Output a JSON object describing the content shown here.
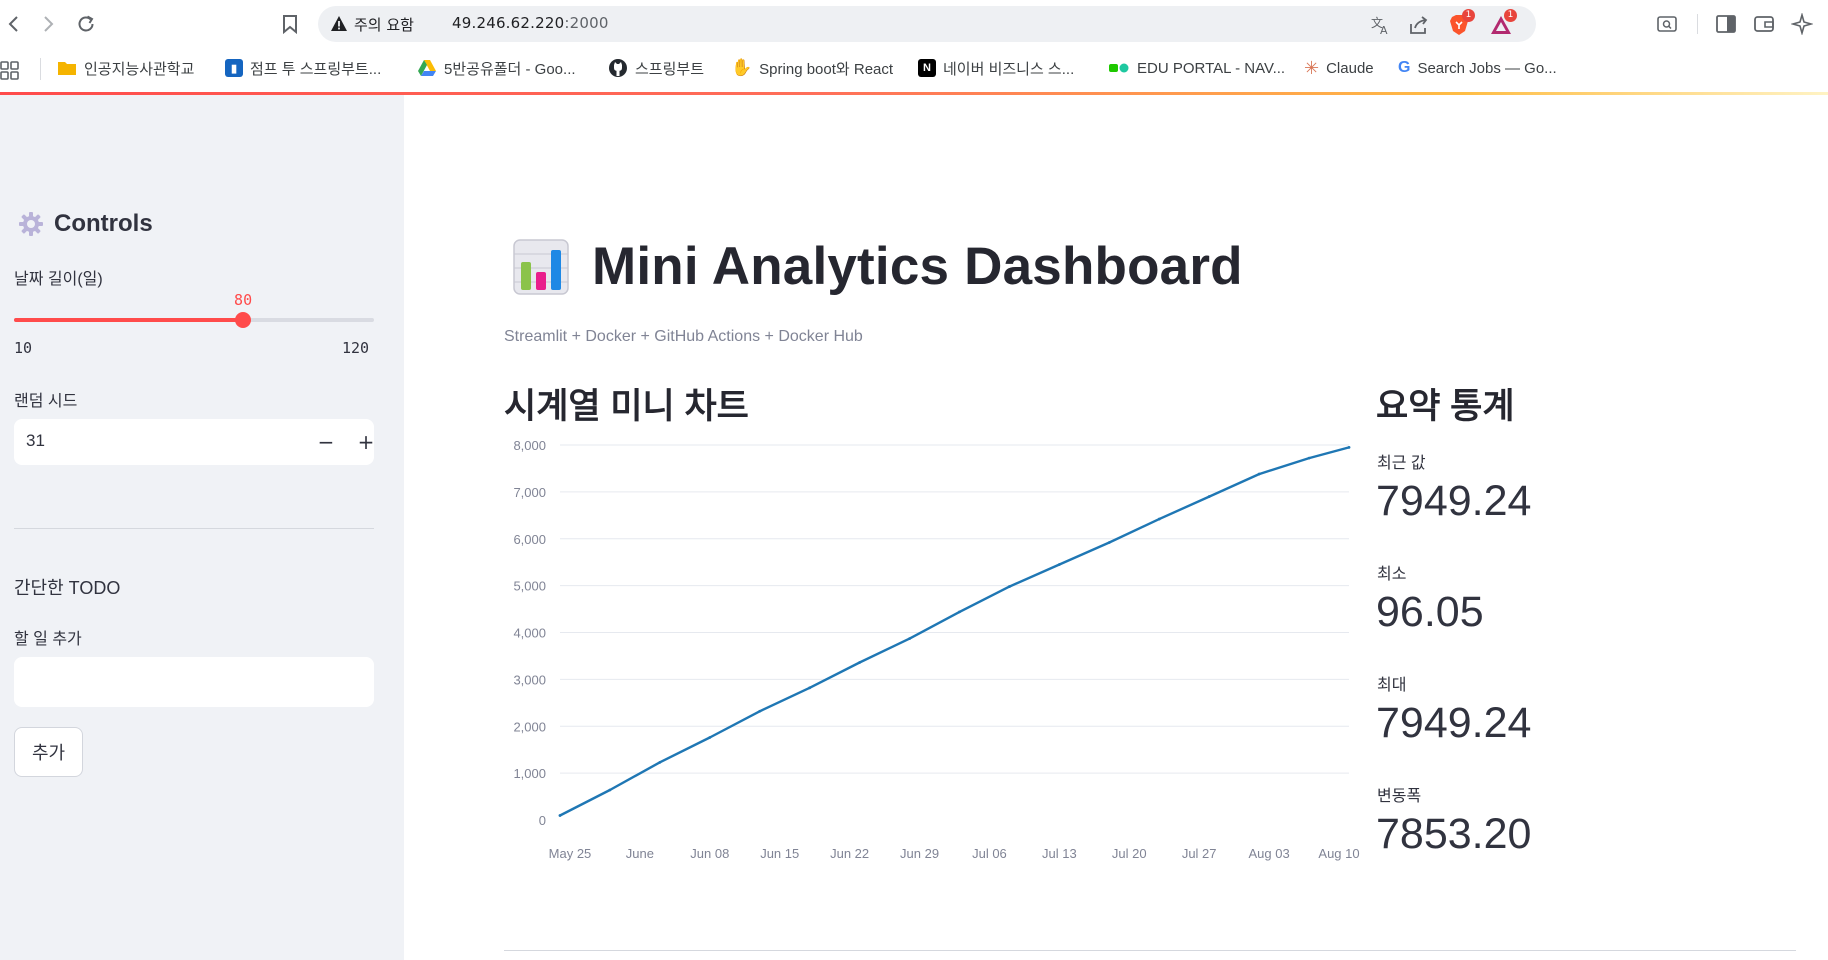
{
  "browser": {
    "security_warning": "주의 요함",
    "url_host": "49.246.62.220",
    "url_port": ":2000",
    "brave_badge": "1",
    "rewards_badge": "1"
  },
  "bookmarks": [
    {
      "label": "인공지능사관학교",
      "icon": "folder-icon",
      "color": "#f5b400"
    },
    {
      "label": "점프 투 스프링부트...",
      "icon": "book-icon",
      "color": "#1565c0"
    },
    {
      "label": "5반공유폴더 - Goo...",
      "icon": "google-drive-icon",
      "color": "#34a853"
    },
    {
      "label": "스프링부트",
      "icon": "github-icon",
      "color": "#24292f"
    },
    {
      "label": "Spring boot와 React",
      "icon": "hand-icon",
      "color": "#f9c23c"
    },
    {
      "label": "네이버 비즈니스 스...",
      "icon": "naver-icon",
      "color": "#000000"
    },
    {
      "label": "EDU PORTAL - NAV...",
      "icon": "edu-portal-icon",
      "color": "#1ec800"
    },
    {
      "label": "Claude",
      "icon": "claude-icon",
      "color": "#d97757"
    },
    {
      "label": "Search Jobs — Go...",
      "icon": "google-icon",
      "color": "#4285f4"
    }
  ],
  "sidebar": {
    "title": "Controls",
    "title_icon": "gear-icon",
    "days": {
      "label": "날짜 길이(일)",
      "value": "80",
      "min": "10",
      "max": "120"
    },
    "seed": {
      "label": "랜덤 시드",
      "value": "31",
      "minus": "−",
      "plus": "+"
    },
    "todo": {
      "heading": "간단한 TODO",
      "input_label": "할 일 추가",
      "input_value": "",
      "button": "추가"
    }
  },
  "main": {
    "title": "Mini Analytics Dashboard",
    "title_icon": "bar-chart-icon",
    "caption": "Streamlit + Docker + GitHub Actions + Docker Hub",
    "chart_heading": "시계열 미니 차트",
    "stats_heading": "요약 통계",
    "metrics": [
      {
        "label": "최근 값",
        "value": "7949.24"
      },
      {
        "label": "최소",
        "value": "96.05"
      },
      {
        "label": "최대",
        "value": "7949.24"
      },
      {
        "label": "변동폭",
        "value": "7853.20"
      }
    ]
  },
  "colors": {
    "accent": "#ff4b4b",
    "line": "#1f77b4",
    "sidebar_bg": "#f0f2f6"
  },
  "chart_data": {
    "type": "line",
    "title": "",
    "xlabel": "",
    "ylabel": "",
    "ylim": [
      0,
      8000
    ],
    "xlim": [
      "2025-05-24",
      "2025-08-11"
    ],
    "grid": true,
    "x_ticks": [
      "May 25",
      "June",
      "Jun 08",
      "Jun 15",
      "Jun 22",
      "Jun 29",
      "Jul 06",
      "Jul 13",
      "Jul 20",
      "Jul 27",
      "Aug 03",
      "Aug 10"
    ],
    "x_tick_dates": [
      "2025-05-25",
      "2025-06-01",
      "2025-06-08",
      "2025-06-15",
      "2025-06-22",
      "2025-06-29",
      "2025-07-06",
      "2025-07-13",
      "2025-07-20",
      "2025-07-27",
      "2025-08-03",
      "2025-08-10"
    ],
    "y_ticks": [
      "0",
      "1,000",
      "2,000",
      "3,000",
      "4,000",
      "5,000",
      "6,000",
      "7,000",
      "8,000"
    ],
    "y_tick_values": [
      0,
      1000,
      2000,
      3000,
      4000,
      5000,
      6000,
      7000,
      8000
    ],
    "series": [
      {
        "x": [
          "2025-05-24",
          "2025-05-29",
          "2025-06-03",
          "2025-06-08",
          "2025-06-13",
          "2025-06-18",
          "2025-06-23",
          "2025-06-28",
          "2025-07-03",
          "2025-07-08",
          "2025-07-13",
          "2025-07-18",
          "2025-07-23",
          "2025-07-28",
          "2025-08-02",
          "2025-08-07",
          "2025-08-11"
        ],
        "values": [
          96.05,
          640,
          1230,
          1760,
          2320,
          2820,
          3360,
          3870,
          4440,
          4980,
          5450,
          5920,
          6420,
          6900,
          7380,
          7720,
          7949.24
        ]
      }
    ]
  }
}
